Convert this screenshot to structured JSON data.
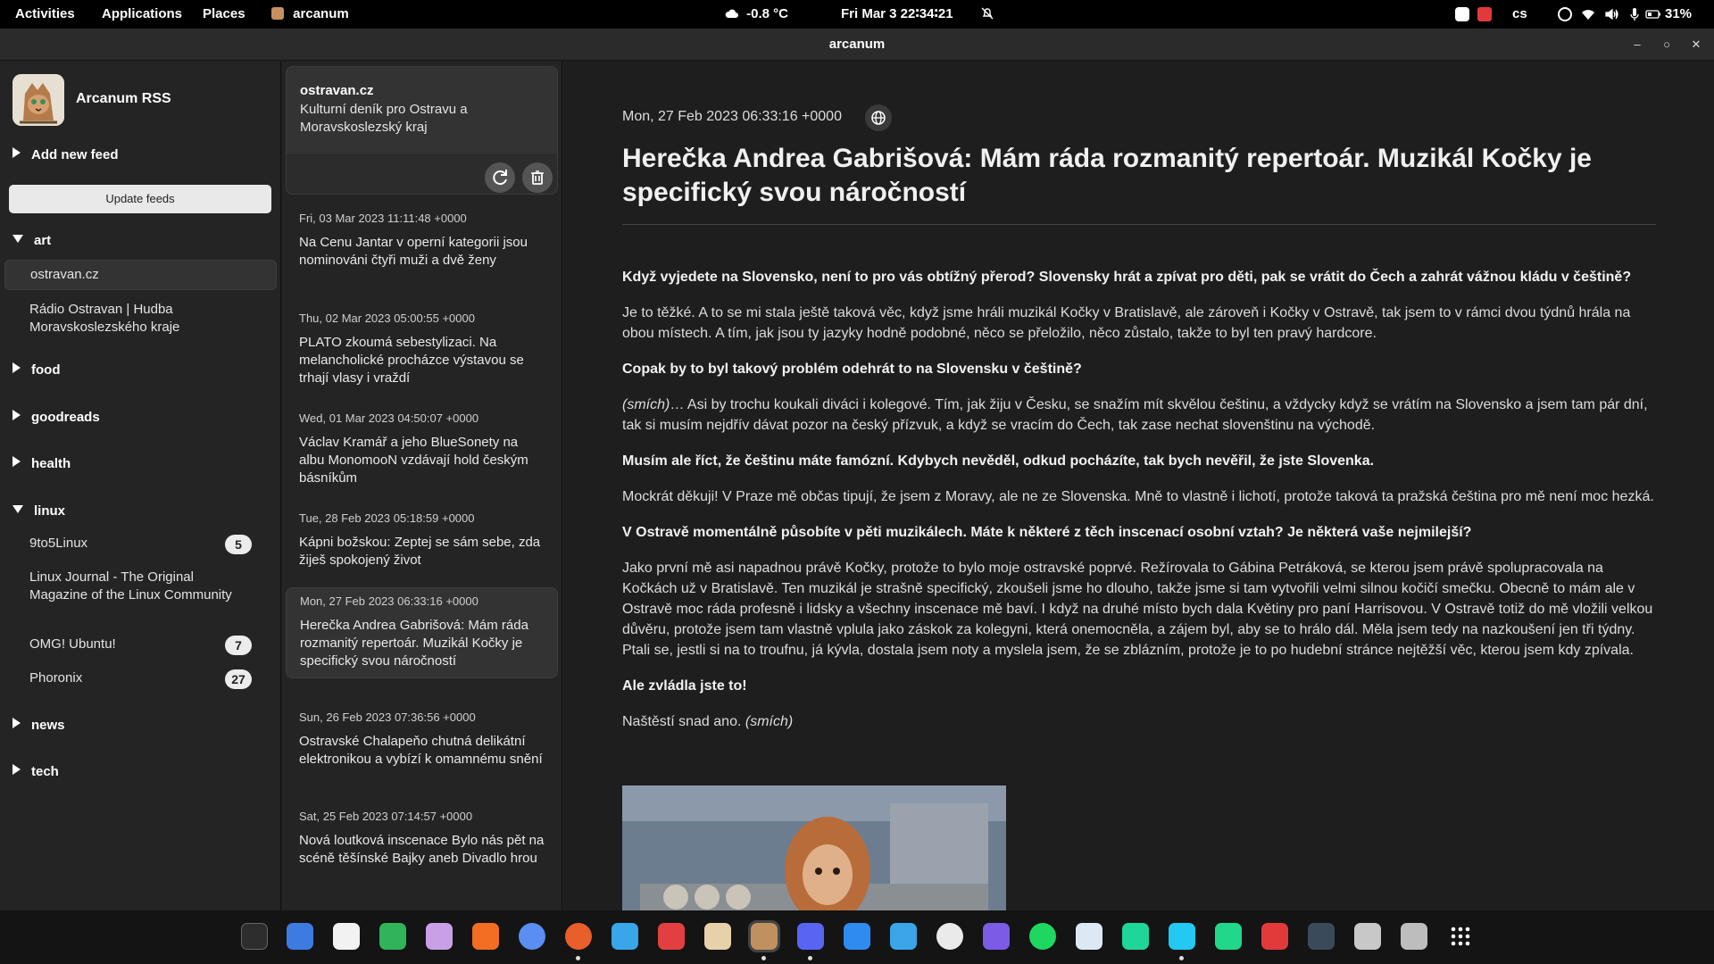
{
  "topbar": {
    "activities": "Activities",
    "applications": "Applications",
    "places": "Places",
    "focused_app": "arcanum",
    "weather": "-0.8 °C",
    "clock": "Fri Mar 3  22∶34∶21",
    "keyboard_layout": "cs",
    "battery": "31%"
  },
  "window": {
    "title": "arcanum"
  },
  "sidebar": {
    "app_name": "Arcanum RSS",
    "add_feed": "Add new feed",
    "update_button": "Update feeds",
    "categories": {
      "art": "art",
      "food": "food",
      "goodreads": "goodreads",
      "health": "health",
      "linux": "linux",
      "news": "news",
      "tech": "tech"
    },
    "feeds": {
      "ostravan": "ostravan.cz",
      "radio": "Rádio Ostravan | Hudba Moravskoslezského kraje",
      "nine2five": "9to5Linux",
      "nine2five_count": "5",
      "linuxjournal": "Linux Journal - The Original Magazine of the Linux Community",
      "omg": "OMG! Ubuntu!",
      "omg_count": "7",
      "phoronix": "Phoronix",
      "phoronix_count": "27"
    }
  },
  "feed_card": {
    "name": "ostravan.cz",
    "description": "Kulturní deník pro Ostravu a Moravskoslezský kraj"
  },
  "articles": [
    {
      "date": "Fri, 03 Mar 2023 11:11:48 +0000",
      "title": "Na Cenu Jantar v operní kategorii jsou nominováni čtyři muži a dvě ženy"
    },
    {
      "date": "Thu, 02 Mar 2023 05:00:55 +0000",
      "title": "PLATO zkoumá sebestylizaci. Na melancholické procházce výstavou se trhají vlasy i vraždí"
    },
    {
      "date": "Wed, 01 Mar 2023 04:50:07 +0000",
      "title": "Václav Kramář a jeho BlueSonety na albu MonomooN vzdávají hold českým básníkům"
    },
    {
      "date": "Tue, 28 Feb 2023 05:18:59 +0000",
      "title": "Kápni božskou: Zeptej se sám sebe, zda žiješ spokojený život"
    },
    {
      "date": "Mon, 27 Feb 2023 06:33:16 +0000",
      "title": "Herečka Andrea Gabrišová: Mám ráda rozmanitý repertoár. Muzikál Kočky je specifický svou náročností"
    },
    {
      "date": "Sun, 26 Feb 2023 07:36:56 +0000",
      "title": "Ostravské Chalapeňo chutná delikátní elektronikou a vybízí k omamnému snění"
    },
    {
      "date": "Sat, 25 Feb 2023 07:14:57 +0000",
      "title": "Nová loutková inscenace Bylo nás pět na scéně těšínské Bajky aneb Divadlo hrou"
    }
  ],
  "article": {
    "date": "Mon, 27 Feb 2023 06:33:16 +0000",
    "title": "Herečka Andrea Gabrišová: Mám ráda rozmanitý repertoár. Muzikál Kočky je specifický svou náročností",
    "q1": "Když vyjedete na Slovensko, není to pro vás obtížný přerod? Slovensky hrát a zpívat pro děti, pak se vrátit do Čech a zahrát vážnou kládu v češtině?",
    "a1": "Je to těžké. A to se mi stala ještě taková věc, když jsme hráli muzikál Kočky v Bratislavě, ale zároveň i Kočky v Ostravě, tak jsem to v rámci dvou týdnů hrála na obou místech. A tím, jak jsou ty jazyky hodně podobné, něco se přeložilo, něco zůstalo, takže to byl ten pravý hardcore.",
    "q2": "Copak by to byl takový problém odehrát to na Slovensku v češtině?",
    "a2_em": "(smích)",
    "a2": "… Asi by trochu koukali diváci i kolegové. Tím, jak žiju v Česku, se snažím mít skvělou češtinu, a vždycky když se vrátím na Slovensko a jsem tam pár dní, tak si musím nejdřív dávat pozor na český přízvuk, a když se vracím do Čech, tak zase nechat slovenštinu na východě.",
    "q3": "Musím ale říct, že češtinu máte famózní. Kdybych nevěděl, odkud pocházíte, tak bych nevěřil, že jste Slovenka.",
    "a3": "Mockrát děkuji! V Praze mě občas tipují, že jsem z Moravy, ale ne ze Slovenska. Mně to vlastně i lichotí, protože taková ta pražská čeština pro mě není moc hezká.",
    "q4": "V Ostravě momentálně působíte v pěti muzikálech. Máte k některé z těch inscenací osobní vztah? Je některá vaše nejmilejší?",
    "a4": "Jako první mě asi napadnou právě Kočky, protože to bylo moje ostravské poprvé. Režírovala to Gábina Petráková, se kterou jsem právě spolupracovala na Kočkách už v Bratislavě. Ten muzikál je strašně specifický, zkoušeli jsme ho dlouho, takže jsme si tam vytvořili velmi silnou kočičí smečku. Obecně to mám ale v Ostravě moc ráda profesně i lidsky a všechny inscenace mě baví. I když na druhé místo bych dala Květiny pro paní Harrisovou. V Ostravě totiž do mě vložili velkou důvěru, protože jsem tam vlastně vplula jako záskok za kolegyni, která onemocněla, a zájem byl, aby se to hrálo dál. Měla jsem tedy na nazkoušení jen tři týdny. Ptali se, jestli si na to troufnu, já kývla, dostala jsem noty a myslela jsem, že se zblázním, protože je to po hudební stránce nejtěžší věc, kterou jsem kdy zpívala.",
    "q5": "Ale zvládla jste to!",
    "a5": "Naštěstí snad ano.",
    "a5_em": "(smích)"
  },
  "colors": {
    "background": "#1e1e1e",
    "sidebar": "#242424",
    "selected": "#333333",
    "topbar": "#000000"
  }
}
